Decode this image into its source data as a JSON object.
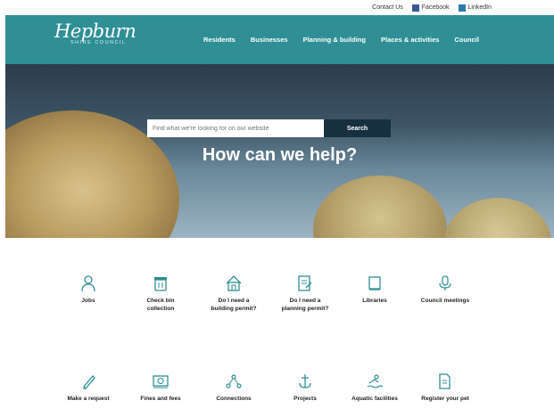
{
  "topbar": {
    "contact": "Contact Us",
    "facebook": "Facebook",
    "linkedin": "LinkedIn"
  },
  "logo": {
    "name": "Hepburn",
    "sub": "SHIRE COUNCIL"
  },
  "nav": [
    "Residents",
    "Businesses",
    "Planning & building",
    "Places & activities",
    "Council"
  ],
  "search": {
    "placeholder": "Find what we're looking for on our website",
    "button": "Search"
  },
  "hero": {
    "title": "How can we help?"
  },
  "tiles_row1": [
    {
      "label": "Jobs",
      "icon": "person-icon"
    },
    {
      "label": "Check bin collection",
      "icon": "bin-icon"
    },
    {
      "label": "Do I need a building permit?",
      "icon": "house-icon"
    },
    {
      "label": "Do I need a planning permit?",
      "icon": "document-edit-icon"
    },
    {
      "label": "Libraries",
      "icon": "book-icon"
    },
    {
      "label": "Council meetings",
      "icon": "microphone-icon"
    }
  ],
  "tiles_row2": [
    {
      "label": "Make a request",
      "icon": "pencil-icon"
    },
    {
      "label": "Fines and fees",
      "icon": "money-icon"
    },
    {
      "label": "Connections",
      "icon": "network-icon"
    },
    {
      "label": "Projects",
      "icon": "anchor-icon"
    },
    {
      "label": "Aquatic facilities",
      "icon": "swimmer-icon"
    },
    {
      "label": "Register your pet",
      "icon": "form-icon"
    }
  ],
  "colors": {
    "nav": "#2f8f95",
    "search_button": "#16303f",
    "icons": "#2f8f95"
  }
}
